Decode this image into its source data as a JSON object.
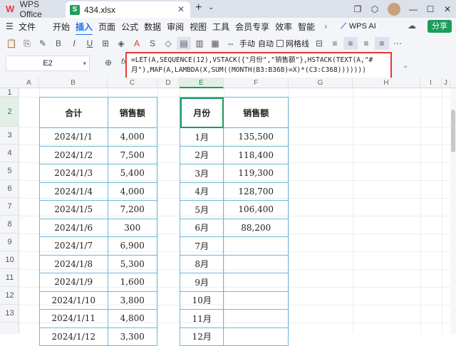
{
  "titlebar": {
    "app_name": "WPS Office",
    "file_tab": "434.xlsx",
    "sheet_icon": "S"
  },
  "menu": {
    "file": "文件",
    "items": [
      "开始",
      "插入",
      "页面",
      "公式",
      "数据",
      "审阅",
      "视图",
      "工具",
      "会员专享",
      "效率",
      "智能"
    ],
    "active_index": 1,
    "wps_ai": "WPS AI",
    "share": "分享"
  },
  "toolbar": {
    "manual": "手动",
    "auto": "自动",
    "gridlines": "网格线"
  },
  "formula_bar": {
    "cell_ref": "E2",
    "fx": "fx",
    "formula": "=LET(A,SEQUENCE(12),VSTACK({\"月份\",\"销售额\"},HSTACK(TEXT(A,\"#月\"),MAP(A,LAMBDA(X,SUM((MONTH(B3:B368)=X)*(C3:C368)))))))"
  },
  "columns": [
    "A",
    "B",
    "C",
    "D",
    "E",
    "F",
    "G",
    "H",
    "I",
    "J"
  ],
  "active_column": "E",
  "rows": [
    "1",
    "2",
    "3",
    "4",
    "5",
    "6",
    "7",
    "8",
    "9",
    "10",
    "11",
    "12",
    "13"
  ],
  "active_row": "2",
  "left_table": {
    "headers": [
      "合计",
      "销售额"
    ],
    "rows": [
      [
        "2024/1/1",
        "4,000"
      ],
      [
        "2024/1/2",
        "7,500"
      ],
      [
        "2024/1/3",
        "5,400"
      ],
      [
        "2024/1/4",
        "4,000"
      ],
      [
        "2024/1/5",
        "7,200"
      ],
      [
        "2024/1/6",
        "300"
      ],
      [
        "2024/1/7",
        "6,900"
      ],
      [
        "2024/1/8",
        "5,300"
      ],
      [
        "2024/1/9",
        "1,600"
      ],
      [
        "2024/1/10",
        "3,800"
      ],
      [
        "2024/1/11",
        "4,800"
      ],
      [
        "2024/1/12",
        "3,300"
      ]
    ]
  },
  "right_table": {
    "headers": [
      "月份",
      "销售额"
    ],
    "rows": [
      [
        "1月",
        "135,500"
      ],
      [
        "2月",
        "118,400"
      ],
      [
        "3月",
        "119,300"
      ],
      [
        "4月",
        "128,700"
      ],
      [
        "5月",
        "106,400"
      ],
      [
        "6月",
        "88,200"
      ],
      [
        "7月",
        ""
      ],
      [
        "8月",
        ""
      ],
      [
        "9月",
        ""
      ],
      [
        "10月",
        ""
      ],
      [
        "11月",
        ""
      ],
      [
        "12月",
        ""
      ]
    ]
  },
  "colors": {
    "accent_green": "#1d9c5b",
    "table_border": "#6fb7dc",
    "highlight_red": "#e53935",
    "menu_active": "#1a73e8"
  }
}
